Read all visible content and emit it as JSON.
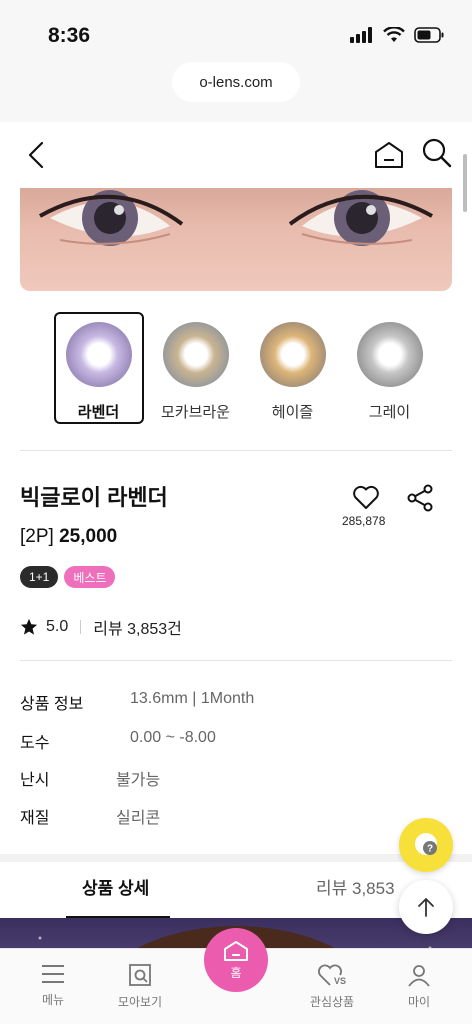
{
  "status_bar": {
    "time": "8:36"
  },
  "browser": {
    "url": "o-lens.com"
  },
  "colors": {
    "accent_pink": "#ec5cae",
    "badge_pink": "#ee6fbb",
    "chat_yellow": "#f7e03a"
  },
  "color_options": [
    {
      "label": "라벤더",
      "selected": true,
      "lens_color": "#b7a8d6"
    },
    {
      "label": "모카브라운",
      "selected": false,
      "lens_color": "#b49a78"
    },
    {
      "label": "헤이즐",
      "selected": false,
      "lens_color": "#c9a166"
    },
    {
      "label": "그레이",
      "selected": false,
      "lens_color": "#a6a6a6"
    }
  ],
  "product": {
    "title": "빅글로이 라벤더",
    "pack": "[2P]",
    "price": "25,000",
    "like_count": "285,878",
    "badges": [
      "1+1",
      "베스트"
    ],
    "rating": "5.0",
    "review_label": "리뷰 3,853건"
  },
  "specs": [
    {
      "key": "상품 정보",
      "value": "13.6mm | 1Month"
    },
    {
      "key": "도수",
      "value": "0.00 ~ -8.00"
    },
    {
      "key": "난시",
      "value": "불가능"
    },
    {
      "key": "재질",
      "value": "실리콘"
    }
  ],
  "tabs": {
    "detail": "상품 상세",
    "review": "리뷰 3,853"
  },
  "bottom_nav": {
    "menu": "메뉴",
    "browse": "모아보기",
    "home": "홈",
    "wishlist": "관심상품",
    "my": "마이"
  }
}
